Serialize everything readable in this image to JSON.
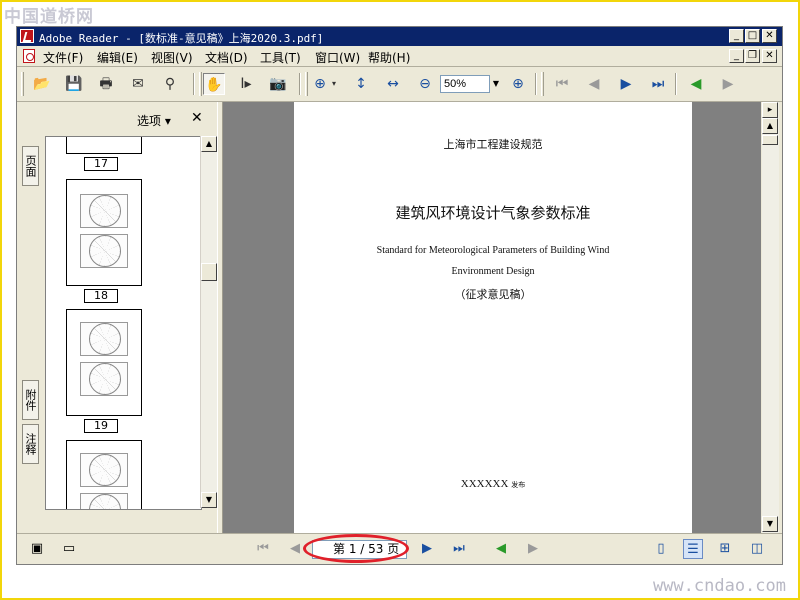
{
  "watermark": {
    "top": "中国道桥网",
    "bottom": "www.cndao.com"
  },
  "window": {
    "title": "Adobe Reader - [数标准-意见稿》上海2020.3.pdf]"
  },
  "menu": [
    "文件(F)",
    "编辑(E)",
    "视图(V)",
    "文档(D)",
    "工具(T)",
    "窗口(W)",
    "帮助(H)"
  ],
  "toolbar": {
    "zoom_value": "50%"
  },
  "side_tabs": {
    "pages": "页面",
    "attachments": "附件",
    "comments": "注释"
  },
  "thumb_panel": {
    "options_label": "选项 ▾",
    "close_glyph": "✕",
    "page_labels": [
      "17",
      "18",
      "19"
    ]
  },
  "document": {
    "line1": "上海市工程建设规范",
    "line2": "建筑风环境设计气象参数标准",
    "line3": "Standard for Meteorological Parameters of Building Wind",
    "line4": "Environment Design",
    "line5": "（征求意见稿）",
    "footer": "XXXXXX",
    "footer_small": "发布"
  },
  "status": {
    "page_indicator": "第 1 / 53 页"
  },
  "colors": {
    "titlebar": "#0a246a",
    "highlight": "#e0202a",
    "frame": "#f2d60a"
  }
}
